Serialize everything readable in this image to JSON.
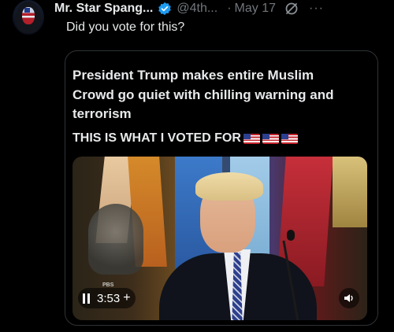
{
  "tweet": {
    "author_name": "Mr. Star Spang...",
    "handle": "@4th...",
    "separator": "·",
    "date": "May 17",
    "more": "···",
    "text": "Did you vote for this?",
    "verified_icon": "verified-badge-icon",
    "grok_icon": "grok-icon"
  },
  "quote": {
    "body": "President Trump makes entire Muslim Crowd go quiet with chilling warning and terrorism",
    "subtitle": "THIS IS WHAT I VOTED FOR",
    "flag_icon": "us-flag-emoji"
  },
  "video": {
    "watermark": "PBS",
    "duration": "3:53",
    "plus": "+",
    "pause_icon": "pause-icon",
    "sound_icon": "speaker-icon"
  },
  "colors": {
    "background": "#000000",
    "text": "#e7e9ea",
    "muted": "#71767b",
    "verified": "#1d9bf0",
    "border": "#2f3336"
  }
}
